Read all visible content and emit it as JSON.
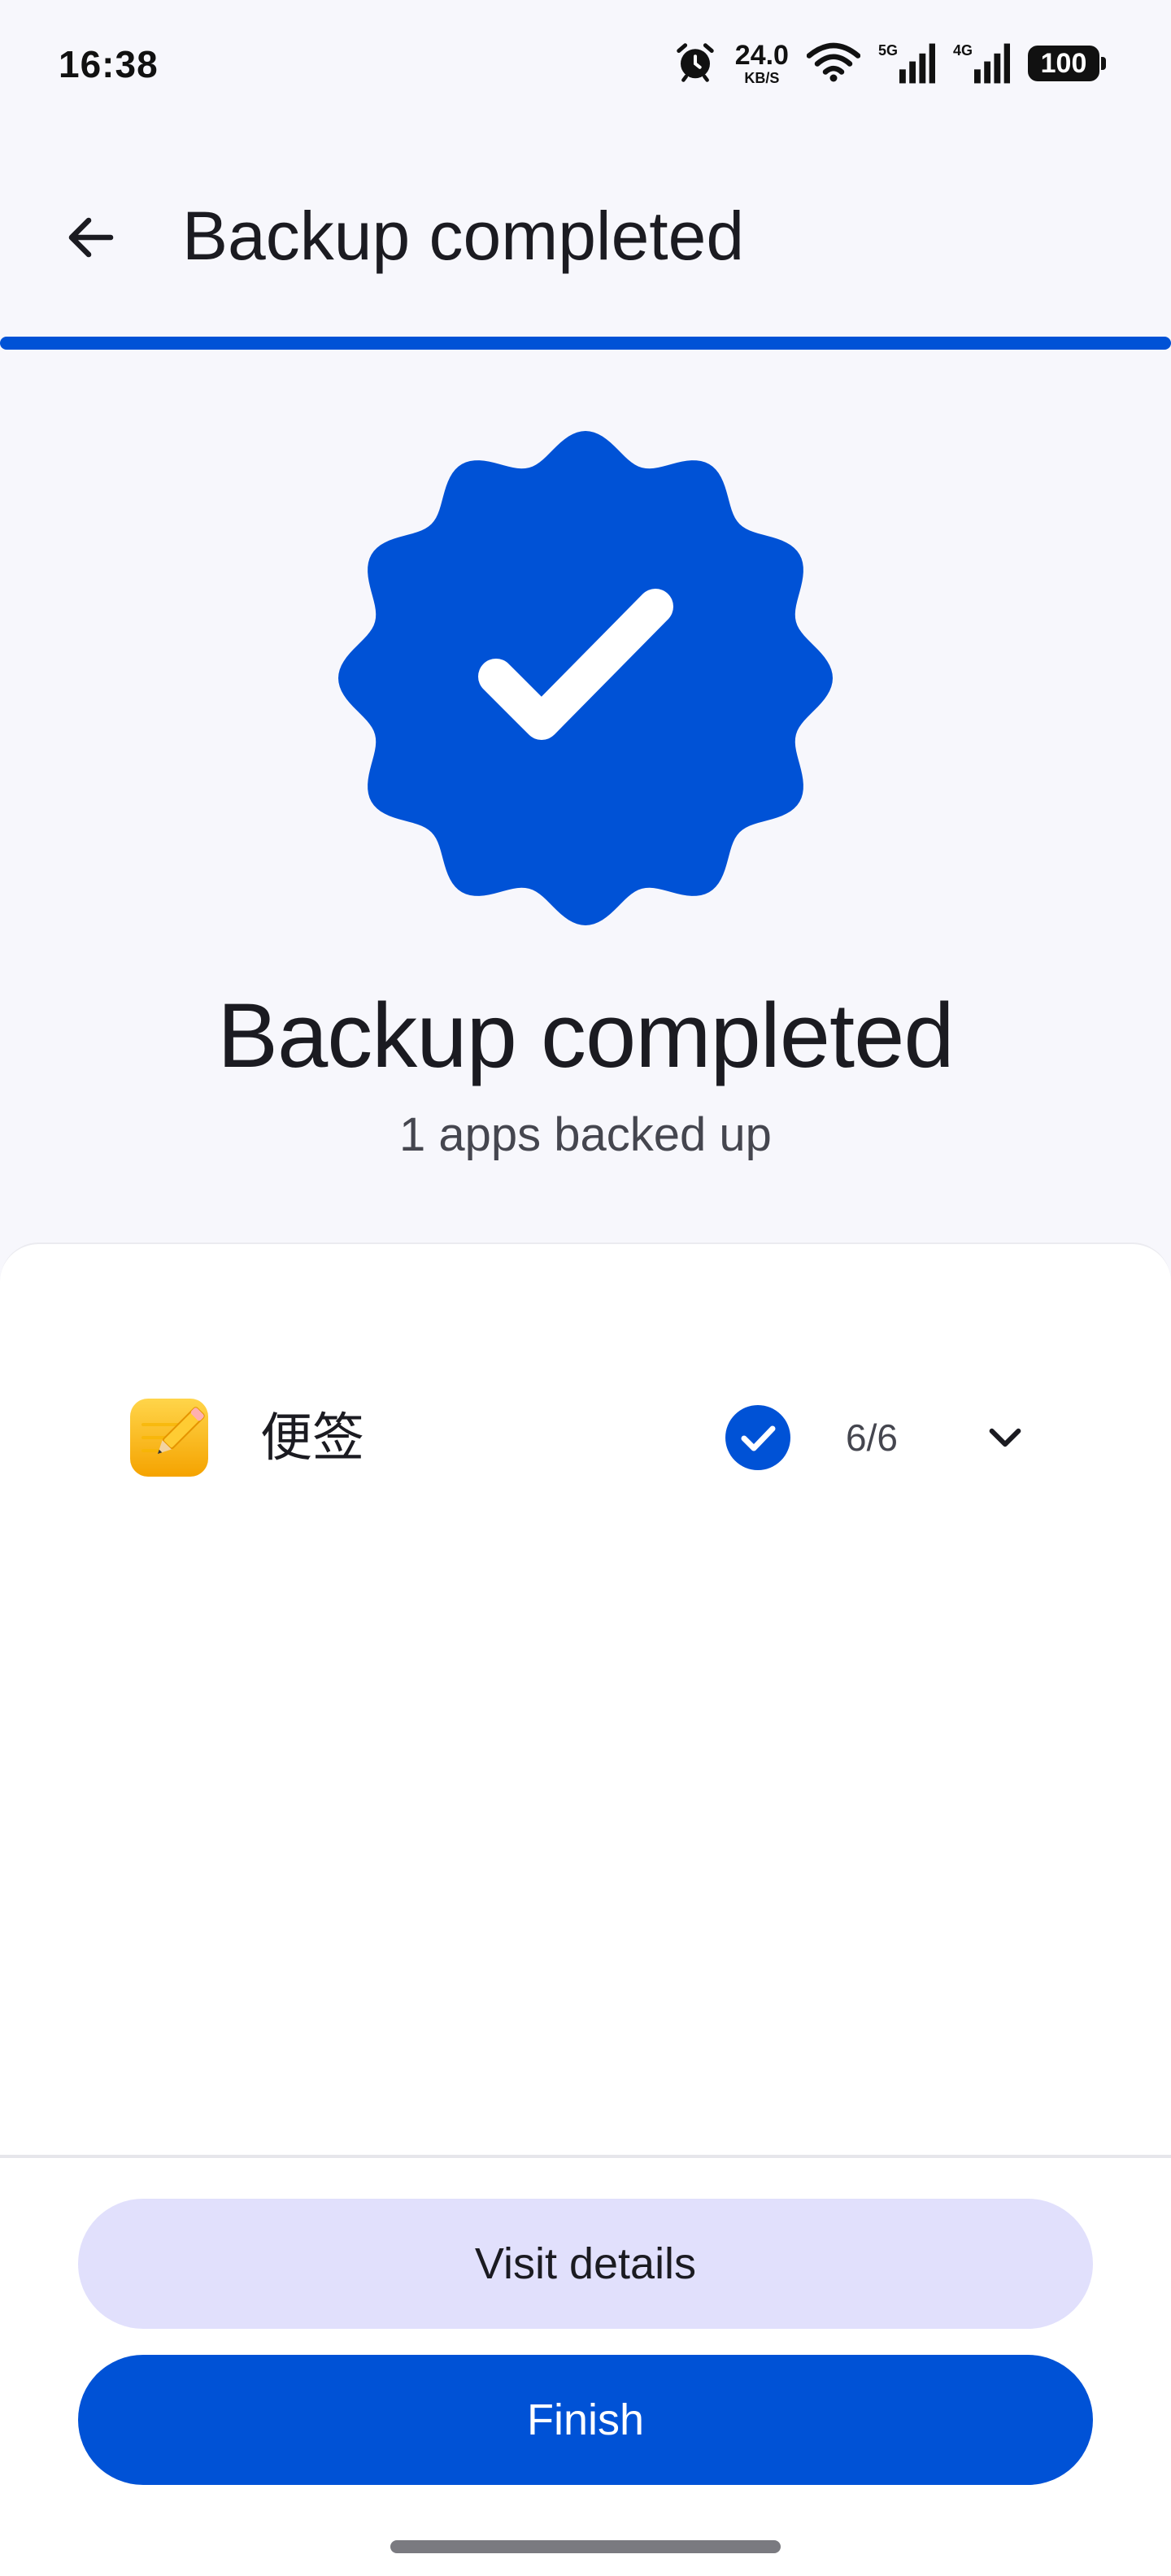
{
  "status_bar": {
    "time": "16:38",
    "net_speed_value": "24.0",
    "net_speed_unit": "KB/S",
    "signal_1_label": "5G",
    "signal_2_label": "4G",
    "battery": "100"
  },
  "app_bar": {
    "title": "Backup completed",
    "back_icon": "arrow-back-icon"
  },
  "hero": {
    "title": "Backup completed",
    "subtitle": "1 apps backed up",
    "badge_icon": "verified-badge-check-icon"
  },
  "apps": [
    {
      "name": "便签",
      "icon": "notes-app-icon",
      "status_icon": "check-circle-icon",
      "count": "6/6",
      "expand_icon": "chevron-down-icon"
    }
  ],
  "actions": {
    "visit_details": "Visit details",
    "finish": "Finish"
  },
  "colors": {
    "accent": "#0052d6",
    "secondary_button": "#e1e0fc",
    "background": "#f7f7fc",
    "card": "#ffffff"
  }
}
